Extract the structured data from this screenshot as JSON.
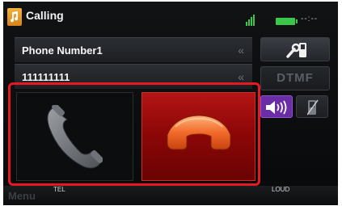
{
  "header": {
    "title": "Calling",
    "status": "--:--",
    "icons": [
      "music-app-icon",
      "signal-icon",
      "battery-icon"
    ]
  },
  "call_info": {
    "name": "Phone Number1",
    "number": "111111111",
    "scroll_glyph": "«"
  },
  "controls": {
    "answer_icon": "phone-answer-icon",
    "hangup_icon": "phone-hangup-icon",
    "phonebook_icon": "phone-settings-icon",
    "dtmf_label": "DTMF",
    "speaker_icon": "speaker-icon",
    "handset_icon": "handset-icon"
  },
  "bottom_bar": {
    "menu_label": "Menu",
    "tel_label": "TEL",
    "loud_label": "LOUD"
  },
  "colors": {
    "highlight": "#e61923",
    "hangup": "#b41515",
    "accent_purple": "#6a2da5",
    "battery": "#3bc84a"
  }
}
